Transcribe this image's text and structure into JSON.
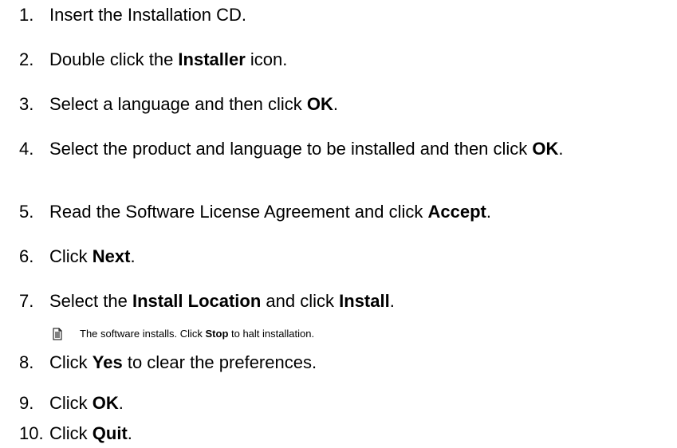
{
  "steps": [
    {
      "num": "1.",
      "parts": [
        "Insert the Installation CD."
      ]
    },
    {
      "num": "2.",
      "parts": [
        "Double click the ",
        "Installer",
        " icon."
      ]
    },
    {
      "num": "3.",
      "parts": [
        "Select a language and then click ",
        "OK",
        "."
      ]
    },
    {
      "num": "4.",
      "parts": [
        "Select the product and language to be installed and then click ",
        "OK",
        "."
      ]
    },
    {
      "num": "5.",
      "parts": [
        "Read the Software License Agreement and click ",
        "Accept",
        "."
      ]
    },
    {
      "num": "6.",
      "parts": [
        "Click ",
        "Next",
        "."
      ]
    },
    {
      "num": "7.",
      "parts": [
        "Select the ",
        "Install Location",
        " and click ",
        "Install",
        "."
      ]
    },
    {
      "num": "8.",
      "parts": [
        "Click ",
        "Yes",
        " to clear the preferences."
      ]
    },
    {
      "num": "9.",
      "parts": [
        "Click ",
        "OK",
        "."
      ]
    },
    {
      "num": "10.",
      "parts": [
        "Click ",
        "Quit",
        "."
      ]
    }
  ],
  "note": {
    "icon": "note-page-icon",
    "parts": [
      "The software installs. Click ",
      "Stop",
      " to halt installation."
    ]
  }
}
